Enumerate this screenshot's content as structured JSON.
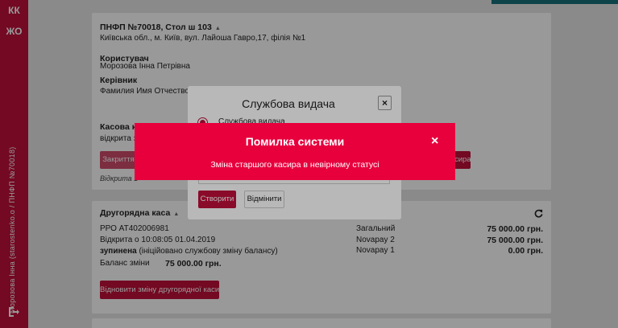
{
  "sidebar": {
    "item_kk": "КК",
    "item_zho": "ЖО",
    "user_vertical": "Морозова Інна (starostenko.o / ПНФП №70018)"
  },
  "branch": {
    "title": "ПНФП №70018, Стол ш 103",
    "address": "Київська обл., м. Київ, вул. Лайоша Гавро,17, філія №1",
    "user_label": "Користувач",
    "user_name": "Морозова Інна Петрівна",
    "manager_label": "Керівник",
    "manager_name": "Фамилия Имя Отчество"
  },
  "main_cash": {
    "title_partial": "Касова кн",
    "status_partial": "відкрита з",
    "close_btn_partial": "Закриття",
    "opened_note_partial": "Відкрита 1",
    "right_btn_partial": "сира"
  },
  "secondary_cash": {
    "title": "Другорядна каса",
    "rro": "РРО AT402006981",
    "opened": "Відкрита о 10:08:05 01.04.2019",
    "status_bold": "зупинена",
    "status_rest": "(ініційовано службову зміну балансу)",
    "balance_label": "Баланс зміни",
    "balance_value": "75 000.00 грн.",
    "restore_button": "Відновити зміну другорядної каси",
    "totals": [
      {
        "label": "Загальний",
        "value": "75 000.00 грн."
      },
      {
        "label": "Novapay 2",
        "value": "75 000.00 грн."
      },
      {
        "label": "Novapay 1",
        "value": "0.00 грн."
      }
    ]
  },
  "service_modal": {
    "title": "Службова видача",
    "close": "×",
    "radio_label": "Службова видача",
    "create_button": "Створити",
    "cancel_button": "Відмінити"
  },
  "error": {
    "title": "Помилка системи",
    "message": "Зміна старшого касира в невірному статусі",
    "close": "×"
  }
}
